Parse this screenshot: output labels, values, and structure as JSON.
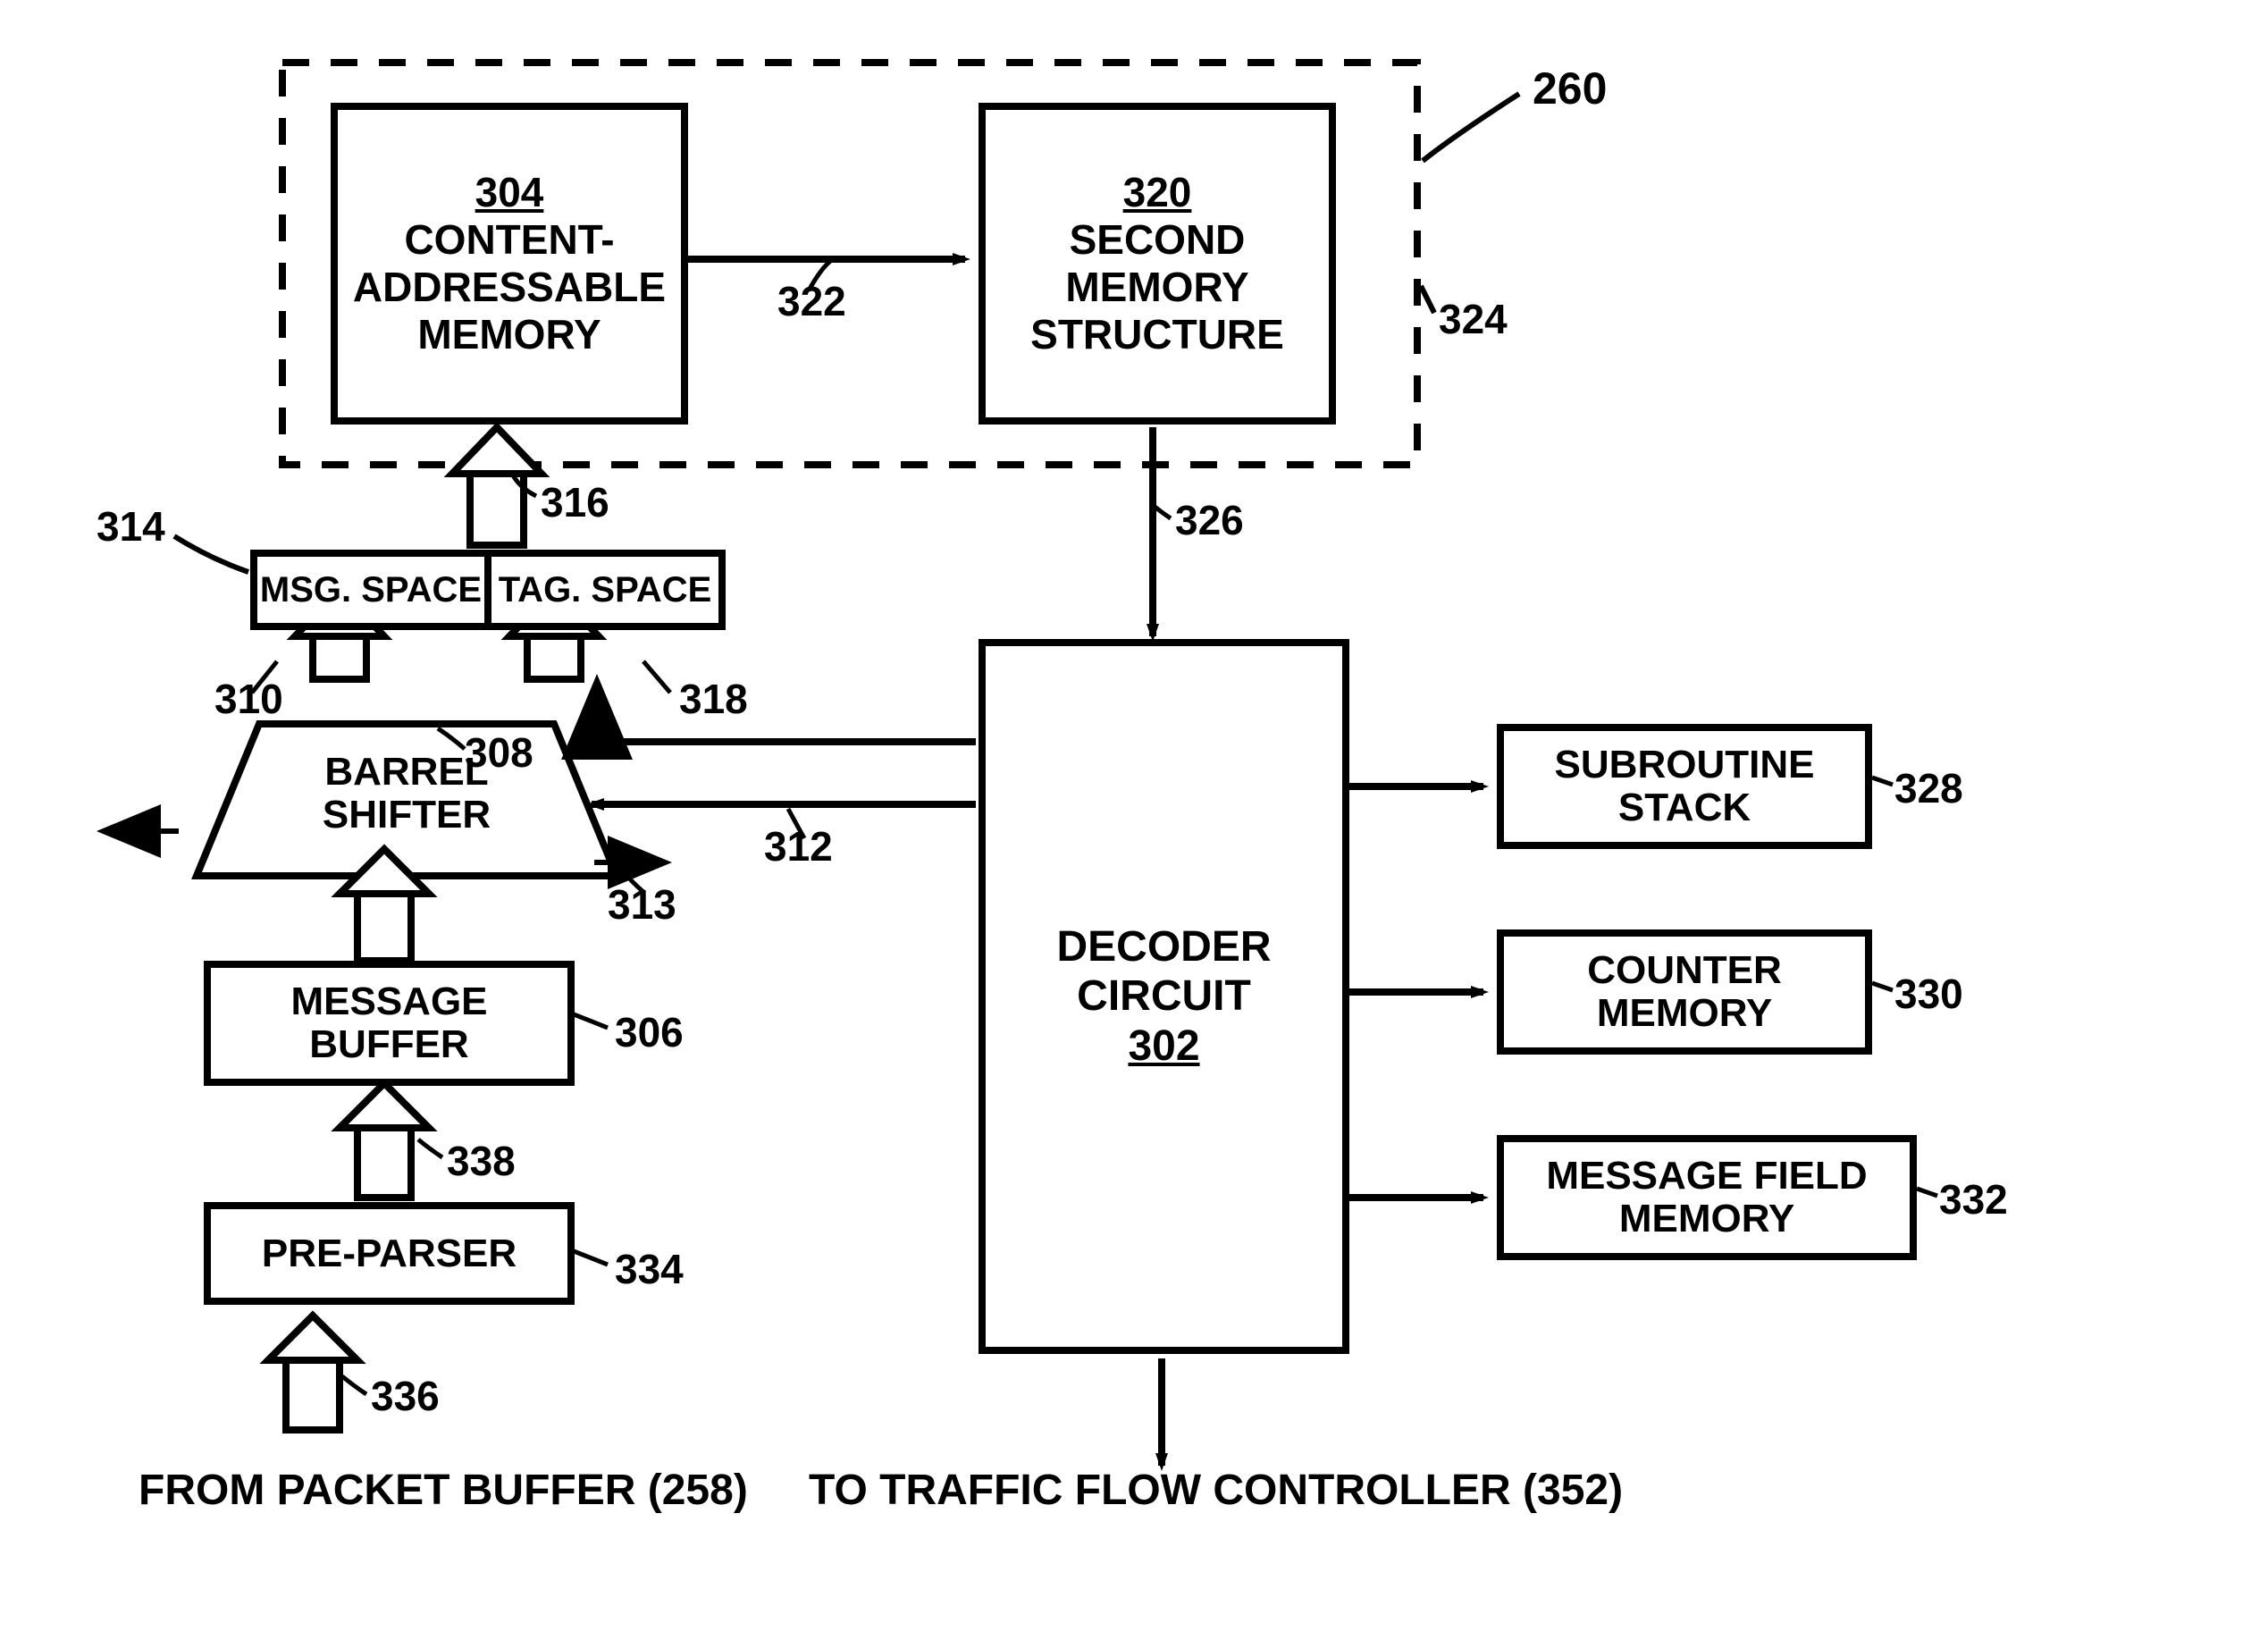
{
  "diagram": {
    "ref_260": "260",
    "ref_304": "304",
    "cam_line1": "CONTENT-",
    "cam_line2": "ADDRESSABLE",
    "cam_line3": "MEMORY",
    "ref_320": "320",
    "sms_line1": "SECOND",
    "sms_line2": "MEMORY",
    "sms_line3": "STRUCTURE",
    "ref_322": "322",
    "ref_324": "324",
    "ref_326": "326",
    "ref_314": "314",
    "ref_316": "316",
    "msg_space": "MSG. SPACE",
    "tag_space": "TAG. SPACE",
    "ref_310": "310",
    "ref_318": "318",
    "ref_308": "308",
    "barrel_line1": "BARREL",
    "barrel_line2": "SHIFTER",
    "ref_312": "312",
    "ref_313": "313",
    "ref_306": "306",
    "msgbuf_line1": "MESSAGE",
    "msgbuf_line2": "BUFFER",
    "ref_338": "338",
    "ref_334": "334",
    "preparser": "PRE-PARSER",
    "ref_336": "336",
    "from_packet_buffer": "FROM PACKET BUFFER (258)",
    "decoder_line1": "DECODER",
    "decoder_line2": "CIRCUIT",
    "ref_302": "302",
    "subr_line1": "SUBROUTINE",
    "subr_line2": "STACK",
    "ref_328": "328",
    "counter_line1": "COUNTER",
    "counter_line2": "MEMORY",
    "ref_330": "330",
    "mfm_line1": "MESSAGE FIELD",
    "mfm_line2": "MEMORY",
    "ref_332": "332",
    "to_traffic": "TO TRAFFIC FLOW CONTROLLER (352)"
  }
}
